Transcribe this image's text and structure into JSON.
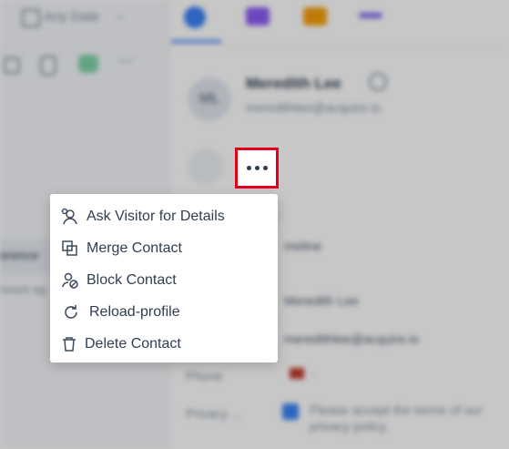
{
  "background": {
    "date_filter_label": "Any Date",
    "left_snippet_1": "erence",
    "left_snippet_2": "nours ag",
    "avatar_initials": "ML",
    "contact_name": "Meredith Lee",
    "contact_email": "meredithlee@acquire.io",
    "field_value_partial": "meline",
    "fields": [
      {
        "label": "",
        "value": "Meredith Lee"
      },
      {
        "label": "",
        "value": "meredithlee@acquire.io"
      },
      {
        "label": "Phone",
        "value": "-"
      },
      {
        "label": "Privacy ...",
        "value": "Please accept the terms of our privacy policy."
      }
    ]
  },
  "more_button": {
    "icon": "ellipsis-icon"
  },
  "context_menu": {
    "items": [
      {
        "label": "Ask Visitor for Details",
        "icon": "ask-visitor-icon"
      },
      {
        "label": "Merge Contact",
        "icon": "merge-icon"
      },
      {
        "label": "Block Contact",
        "icon": "block-user-icon"
      },
      {
        "label": "Reload-profile",
        "icon": "reload-icon"
      },
      {
        "label": "Delete Contact",
        "icon": "trash-icon"
      }
    ]
  },
  "colors": {
    "highlight": "#e3001b",
    "accent": "#3b82f6"
  }
}
